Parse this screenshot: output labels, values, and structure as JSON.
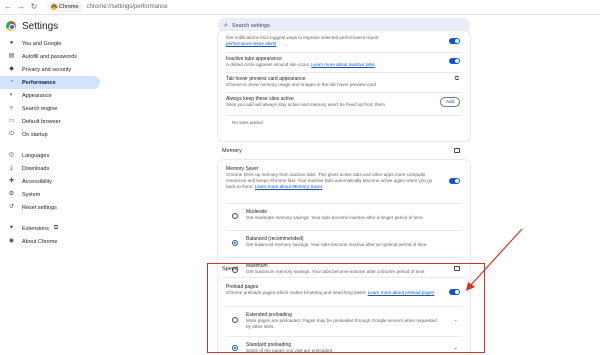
{
  "browser": {
    "origin_label": "Chrome",
    "url": "chrome://settings/performance",
    "nav": [
      "←",
      "→",
      "↻"
    ]
  },
  "header": {
    "title": "Settings",
    "search_placeholder": "Search settings"
  },
  "sidebar": {
    "items": [
      {
        "label": "You and Google",
        "icon": "person-icon",
        "glyph": "●"
      },
      {
        "label": "Autofill and passwords",
        "icon": "autofill-icon",
        "glyph": "▤"
      },
      {
        "label": "Privacy and security",
        "icon": "shield-icon",
        "glyph": "◆"
      },
      {
        "label": "Performance",
        "icon": "speedometer-icon",
        "glyph": "◔",
        "active": true
      },
      {
        "label": "Appearance",
        "icon": "palette-icon",
        "glyph": "◐"
      },
      {
        "label": "Search engine",
        "icon": "search-icon",
        "glyph": "⌕"
      },
      {
        "label": "Default browser",
        "icon": "browser-icon",
        "glyph": "▭"
      },
      {
        "label": "On startup",
        "icon": "power-icon",
        "glyph": "⏻"
      },
      {
        "label": "Languages",
        "icon": "globe-icon",
        "glyph": "◎"
      },
      {
        "label": "Downloads",
        "icon": "download-icon",
        "glyph": "⤓"
      },
      {
        "label": "Accessibility",
        "icon": "accessibility-icon",
        "glyph": "✚"
      },
      {
        "label": "System",
        "icon": "wrench-icon",
        "glyph": "⚙"
      },
      {
        "label": "Reset settings",
        "icon": "reset-icon",
        "glyph": "↺"
      },
      {
        "label": "Extensions",
        "icon": "extension-icon",
        "glyph": "✦",
        "external_glyph": "⧉"
      },
      {
        "label": "About Chrome",
        "icon": "chrome-icon",
        "glyph": "◉"
      }
    ]
  },
  "tabs_card": {
    "partial_text": "Get notifications that suggest ways to improve selected performance report",
    "partial_link": "performance issue alerts",
    "inactive_title": "Inactive tabs appearance",
    "inactive_sub": "A dotted circle appears around site icons.",
    "inactive_link": "Learn more about inactive tabs",
    "hover_title": "Tab hover preview card appearance",
    "hover_sub": "Choose to show memory usage and images in the tab hover preview card",
    "keep_title": "Always keep these sites active",
    "keep_sub": "Sites you add will always stay active and memory won't be freed up from them",
    "add_button": "Add",
    "no_sites": "No sites added"
  },
  "memory": {
    "section_title": "Memory",
    "saver_title": "Memory Saver",
    "saver_sub": "Chrome frees up memory from inactive tabs. This gives active tabs and other apps more computer resources and keeps Chrome fast. Your inactive tabs automatically become active again when you go back to them.",
    "saver_link": "Learn more about Memory Saver",
    "options": [
      {
        "title": "Moderate",
        "sub": "Get moderate memory savings. Your tabs become inactive after a longer period of time.",
        "checked": false
      },
      {
        "title": "Balanced (recommended)",
        "sub": "Get balanced memory savings. Your tabs become inactive after an optimal period of time.",
        "checked": true
      },
      {
        "title": "Maximum",
        "sub": "Get maximum memory savings. Your tabs become inactive after a shorter period of time.",
        "checked": false
      }
    ]
  },
  "speed": {
    "section_title": "Speed",
    "preload_title": "Preload pages",
    "preload_sub": "Chrome preloads pages which makes browsing and searching faster.",
    "preload_link": "Learn more about preload pages",
    "options": [
      {
        "title": "Extended preloading",
        "sub": "More pages are preloaded. Pages may be preloaded through Google servers when requested by other sites.",
        "checked": false
      },
      {
        "title": "Standard preloading",
        "sub": "Some of the pages you visit are preloaded",
        "checked": true
      }
    ]
  },
  "colors": {
    "accent": "#0b57d0",
    "active_nav": "#d3e3fd",
    "annotation": "#d93025"
  }
}
